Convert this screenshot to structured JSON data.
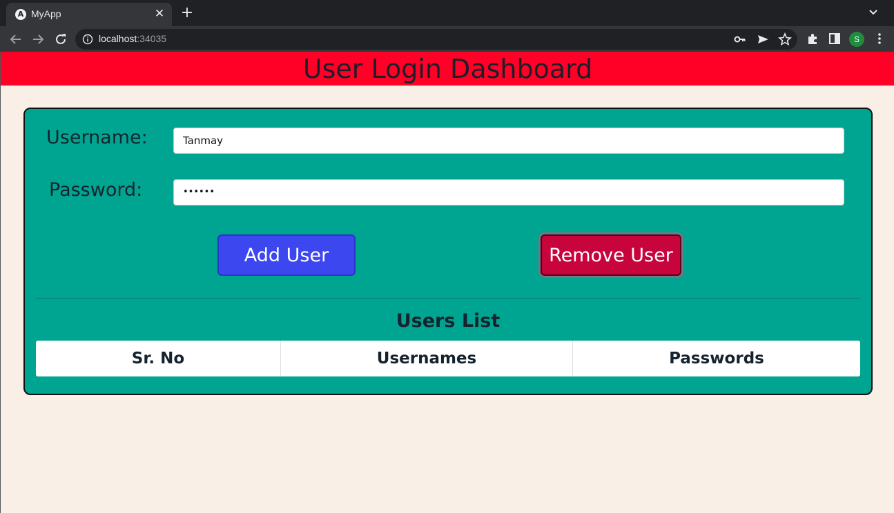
{
  "browser": {
    "tab_title": "MyApp",
    "tab_icon": "A",
    "tab_close": "✕",
    "new_tab": "+",
    "url_host": "localhost",
    "url_port": ":34035",
    "profile_initial": "S"
  },
  "page": {
    "header_title": "User Login Dashboard",
    "header_color": "#ff0026",
    "card_color": "#00a591"
  },
  "form": {
    "username_label": "Username:",
    "username_value": "Tanmay",
    "password_label": "Password:",
    "password_value": "••••••",
    "add_button": "Add User",
    "remove_button": "Remove User"
  },
  "users_list": {
    "title": "Users List",
    "columns": [
      "Sr. No",
      "Usernames",
      "Passwords"
    ],
    "rows": []
  }
}
